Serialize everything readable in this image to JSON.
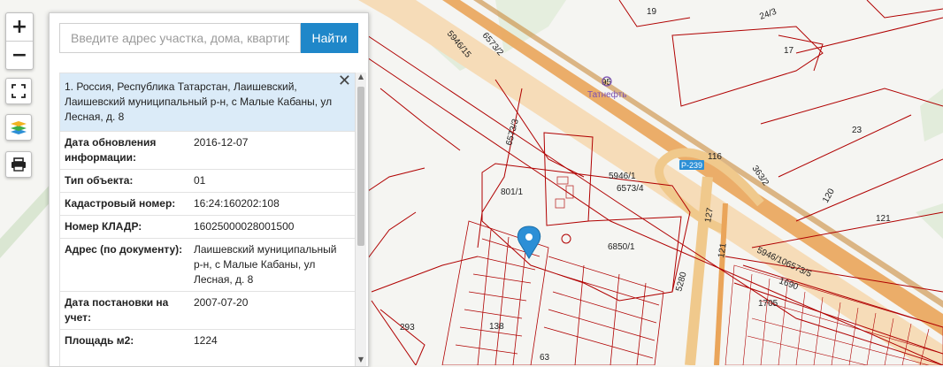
{
  "map_controls": {
    "zoom_in": "+",
    "zoom_out": "−"
  },
  "search": {
    "placeholder": "Введите адрес участка, дома, квартиры",
    "button": "Найти"
  },
  "result": {
    "title": "1. Россия, Республика Татарстан, Лаишевский, Лаишевский муниципальный р-н, с Малые Кабаны, ул Лесная, д. 8",
    "close": "✕",
    "fields": [
      {
        "key": "Дата обновления информации:",
        "value": "2016-12-07"
      },
      {
        "key": "Тип объекта:",
        "value": "01"
      },
      {
        "key": "Кадастровый номер:",
        "value": "16:24:160202:108"
      },
      {
        "key": "Номер КЛАДР:",
        "value": "16025000028001500"
      },
      {
        "key": "Адрес (по документу):",
        "value": "Лаишевский муниципальный р-н, с Малые Кабаны, ул Лесная, д. 8"
      },
      {
        "key": "Дата постановки на учет:",
        "value": "2007-07-20"
      },
      {
        "key": "Площадь м2:",
        "value": "1224"
      }
    ]
  },
  "map_labels": {
    "l19": "19",
    "l243": "24/3",
    "l17": "17",
    "l5946_15": "5946/15",
    "l6573_2": "6573/2",
    "l95": "95",
    "tatneft": "Татнефть",
    "l23": "23",
    "l6573_3": "6573/3",
    "l116": "116",
    "road": "Р-239",
    "l363_2": "363/2",
    "l5946_1": "5946/1",
    "l6573_4": "6573/4",
    "l801_1": "801/1",
    "l120": "120",
    "l127": "127",
    "l121a": "121",
    "l121b": "121",
    "l6850_1": "6850/1",
    "l5946_10": "5946/106573/5",
    "l1690": "1690",
    "l5280": "5280",
    "l1705": "1705",
    "l293": "293",
    "l138": "138",
    "l63": "63"
  },
  "colors": {
    "parcel_line": "#b00000",
    "road_fill": "#f2c48a",
    "search_button": "#1f87c9",
    "result_header": "#dbebf8",
    "marker": "#2c8fd6"
  }
}
